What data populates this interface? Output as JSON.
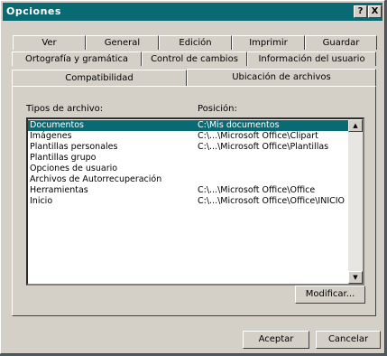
{
  "window": {
    "title": "Opciones"
  },
  "titlebar_buttons": {
    "help": "?",
    "close": "X"
  },
  "tabs": {
    "row1": [
      "Ver",
      "General",
      "Edición",
      "Imprimir",
      "Guardar"
    ],
    "row2": [
      "Ortografía y gramática",
      "Control de cambios",
      "Información del usuario"
    ],
    "row3": [
      "Compatibilidad",
      "Ubicación de archivos"
    ]
  },
  "panel": {
    "col_types": "Tipos de archivo:",
    "col_location": "Posición:",
    "items": [
      {
        "type": "Documentos",
        "location": "C:\\Mis documentos",
        "selected": true
      },
      {
        "type": "Imágenes",
        "location": "C:\\...\\Microsoft Office\\Clipart"
      },
      {
        "type": "Plantillas personales",
        "location": "C:\\...\\Microsoft Office\\Plantillas"
      },
      {
        "type": "Plantillas grupo",
        "location": ""
      },
      {
        "type": "Opciones de usuario",
        "location": ""
      },
      {
        "type": "Archivos de Autorrecuperación",
        "location": ""
      },
      {
        "type": "Herramientas",
        "location": "C:\\...\\Microsoft Office\\Office"
      },
      {
        "type": "Inicio",
        "location": "C:\\...\\Microsoft Office\\Office\\INICIO"
      }
    ],
    "modify_button": "Modificar..."
  },
  "footer": {
    "accept": "Aceptar",
    "cancel": "Cancelar"
  },
  "colors": {
    "titlebar": "#0a6a74",
    "selection": "#0a6a74",
    "face": "#d4d0c8"
  }
}
